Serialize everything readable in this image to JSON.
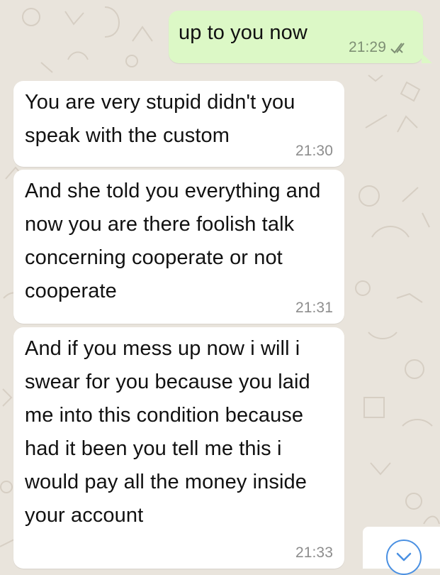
{
  "background_color": "#e9e4dc",
  "accent_color": "#4a90e2",
  "messages": [
    {
      "direction": "outgoing",
      "text": "up to you now",
      "time": "21:29",
      "status_icon": "double-check-icon"
    },
    {
      "direction": "incoming",
      "text": "You are very stupid didn't you speak with the custom",
      "time": "21:30"
    },
    {
      "direction": "incoming",
      "text": "And she told you everything and now you are there foolish talk concerning cooperate or not cooperate",
      "time": "21:31"
    },
    {
      "direction": "incoming",
      "text": "And if you mess up now i will i swear for you because you laid me into this condition because had it been you tell me this i would pay all the money inside your account",
      "time": "21:33"
    }
  ],
  "scroll_button": {
    "icon": "chevron-down-icon"
  }
}
